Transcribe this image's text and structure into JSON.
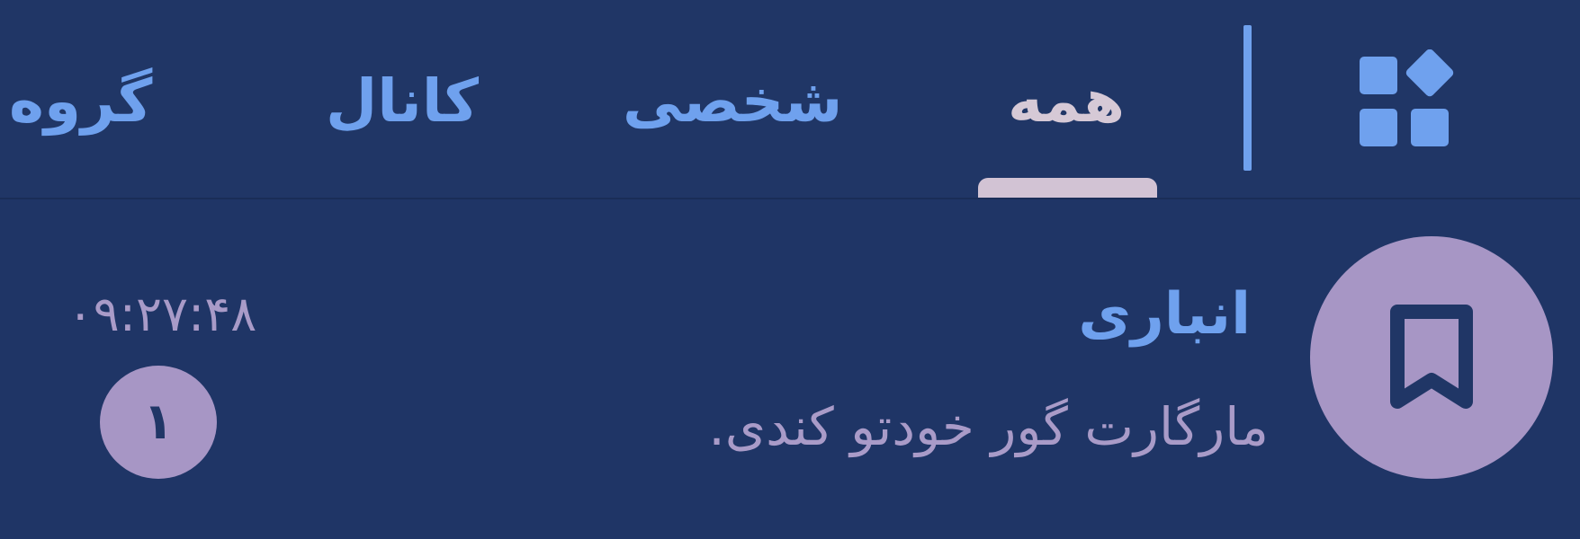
{
  "colors": {
    "background": "#1f3566",
    "accent_blue": "#6fa1ee",
    "active_tab_text": "#d6c9d6",
    "accent_lavender": "#a796c5",
    "secondary_text": "#a99bc8"
  },
  "tabbar": {
    "folders_icon": "grid-shapes-icon",
    "tabs": [
      {
        "label": "همه",
        "active": true
      },
      {
        "label": "شخصی",
        "active": false
      },
      {
        "label": "کانال",
        "active": false
      },
      {
        "label": "گروه",
        "active": false
      }
    ]
  },
  "chat": {
    "avatar_icon": "bookmark-icon",
    "title": "انباری",
    "preview": "مارگارت گور خودتو کندی.",
    "time": "۰۹:۲۷:۴۸",
    "unread_count": "۱"
  }
}
